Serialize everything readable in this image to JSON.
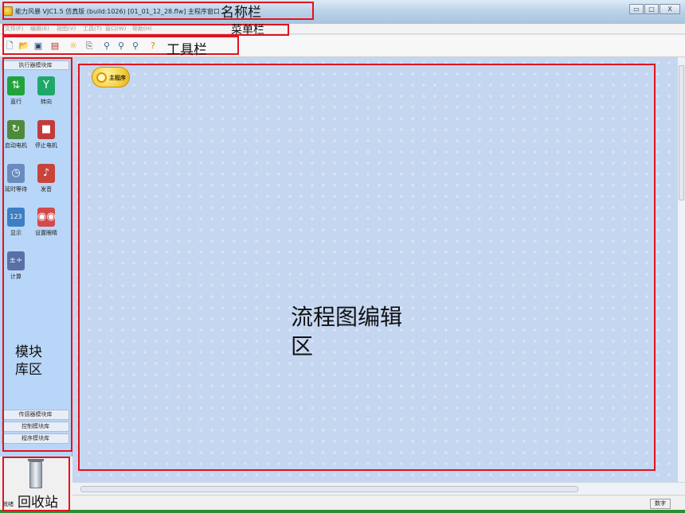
{
  "window": {
    "title": "能力风暴 VJC1.5 仿真版 (build:1026) [01_01_12_28.flw]   主程序窗口",
    "buttons": [
      "▭",
      "□",
      "X"
    ]
  },
  "menu": [
    "文件(F)",
    "编辑(E)",
    "视图(V)",
    "工具(T)",
    "窗口(W)",
    "帮助(H)"
  ],
  "toolbar": {
    "icons": [
      "new-file-icon",
      "open-folder-icon",
      "save-icon",
      "download-icon",
      "run-icon",
      "page-icon",
      "zoom-in-icon",
      "zoom-out-icon",
      "zoom-reset-icon",
      "help-icon"
    ]
  },
  "left_panel": {
    "header": "执行器模块库",
    "modules": [
      {
        "label": "直行",
        "icon": "straight-arrows-icon",
        "color": "#1fa33a"
      },
      {
        "label": "转向",
        "icon": "turn-arrow-icon",
        "color": "#20a86b"
      },
      {
        "label": "启动电机",
        "icon": "start-motor-icon",
        "color": "#4f8a3c"
      },
      {
        "label": "停止电机",
        "icon": "stop-motor-icon",
        "color": "#c23b3b"
      },
      {
        "label": "延时等待",
        "icon": "delay-timer-icon",
        "color": "#6a8bbf"
      },
      {
        "label": "发音",
        "icon": "sound-icon",
        "color": "#c8443a"
      },
      {
        "label": "显示",
        "icon": "display-icon",
        "color": "#3c7fc4"
      },
      {
        "label": "设置眼睛",
        "icon": "eyes-icon",
        "color": "#d24a4a"
      },
      {
        "label": "计算",
        "icon": "calculate-icon",
        "color": "#5a6fa8"
      }
    ],
    "bottom_tabs": [
      "传感器模块库",
      "控制模块库",
      "程序模块库"
    ]
  },
  "canvas": {
    "start_node": "主程序"
  },
  "status": {
    "ready": "就绪",
    "num": "数字"
  },
  "annotations": {
    "title_bar": "名称栏",
    "menu_bar": "菜单栏",
    "toolbar": "工具栏",
    "module_library_line1": "模块",
    "module_library_line2": "库区",
    "flowchart_line1": "流程图编辑",
    "flowchart_line2": "区",
    "recycle_bin": "回收站"
  },
  "colors": {
    "annotation_red": "#e0141e",
    "canvas_blue": "#c5d6f1",
    "panel_blue": "#b8d6f7"
  }
}
